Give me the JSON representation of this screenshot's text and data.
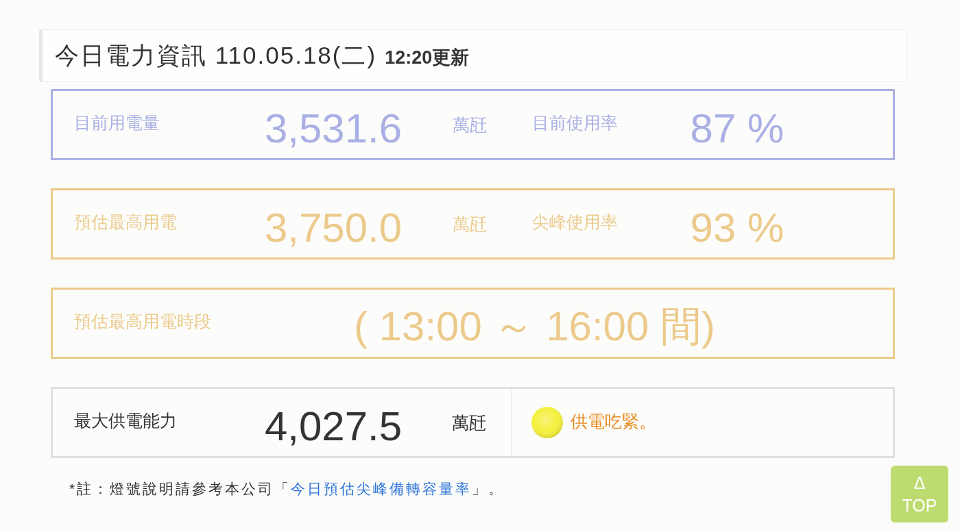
{
  "header": {
    "title": "今日電力資訊 110.05.18(二)",
    "updated": "12:20更新"
  },
  "panels": [
    {
      "kind": "reading",
      "color": "#aab0e4",
      "label": "目前用電量",
      "value": "3,531.6",
      "unit": "萬瓩",
      "rate_label": "目前使用率",
      "rate": "87 %"
    },
    {
      "kind": "reading",
      "color": "#ecca8c",
      "label": "預估最高用電",
      "value": "3,750.0",
      "unit": "萬瓩",
      "rate_label": "尖峰使用率",
      "rate": "93 %"
    },
    {
      "kind": "period",
      "color": "#ecca8c",
      "label": "預估最高用電時段",
      "value": "( 13:00 ～ 16:00 間)"
    },
    {
      "kind": "supply",
      "color": "#e1dee4",
      "label": "最大供電能力",
      "value": "4,027.5",
      "unit": "萬瓩",
      "status": {
        "color": "#f4f03c",
        "text": "供電吃緊。"
      }
    }
  ],
  "note": {
    "text_before": "*註：燈號說明請參考本公司「",
    "link": "今日預估尖峰備轉容量率",
    "text_after": "」。"
  },
  "top_button": {
    "arrow": "Δ",
    "label": "TOP"
  }
}
